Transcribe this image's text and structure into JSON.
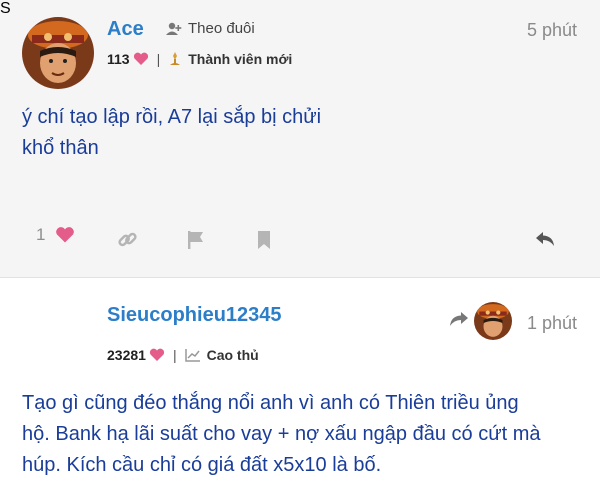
{
  "posts": [
    {
      "username": "Ace",
      "follow_label": "Theo đuôi",
      "time": "5 phút",
      "likes_received": "113",
      "role": "Thành viên mới",
      "text_lines": [
        "ý chí tạo lập rồi, A7 lại sắp bị chửi",
        "khổ thân"
      ],
      "like_count": "1"
    },
    {
      "username": "Sieucophieu12345",
      "avatar_letter": "S",
      "time": "1 phút",
      "likes_received": "23281",
      "role": "Cao thủ",
      "text_lines": [
        "Tạo gì cũng đéo thắng nổi anh vì anh có Thiên triều ủng",
        "hộ. Bank hạ lãi suất cho vay + nợ xấu ngập đầu có cứt mà",
        "húp. Kích cầu chỉ có giá đất x5x10 là bố."
      ]
    }
  ],
  "colors": {
    "username": "#2c7ec8",
    "body_text": "#1a3d99",
    "heart": "#e45c8a",
    "avatar_s": "#ef7d25",
    "icon_gray": "#aaaaaa"
  }
}
